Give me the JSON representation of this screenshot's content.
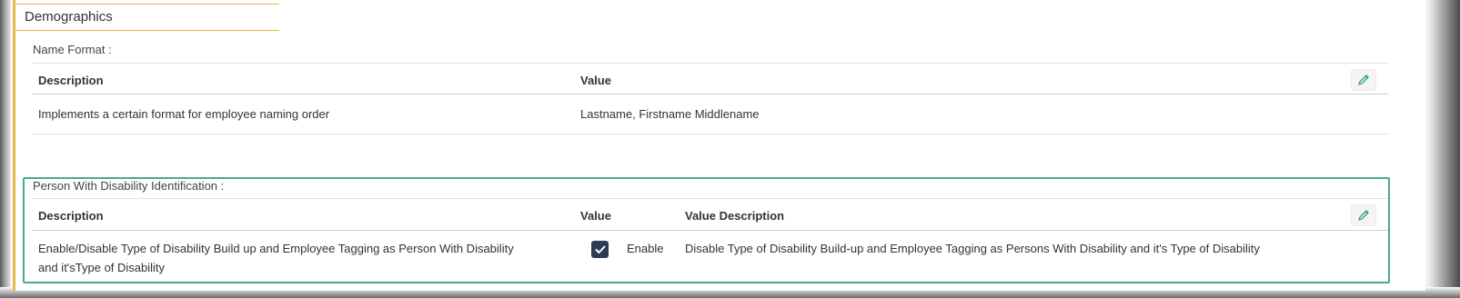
{
  "section": {
    "title": "Demographics"
  },
  "name_format": {
    "label": "Name Format :",
    "headers": {
      "description": "Description",
      "value": "Value"
    },
    "row": {
      "description": "Implements a certain format for employee naming order",
      "value": "Lastname, Firstname Middlename"
    }
  },
  "pwd": {
    "label": "Person With Disability Identification :",
    "headers": {
      "description": "Description",
      "value": "Value",
      "value_description": "Value Description"
    },
    "row": {
      "description_line1": "Enable/Disable Type of Disability Build up and Employee Tagging as Person With Disability",
      "description_line2": "and it'sType of Disability",
      "checked": true,
      "value": "Enable",
      "value_description": "Disable Type of Disability Build-up and Employee Tagging as Persons With Disability and it's Type of Disability"
    }
  },
  "colors": {
    "accent_gold": "#e6b74a",
    "highlight_green": "#4aa98a",
    "edit_icon_green": "#3aa76d",
    "checkbox_fill": "#2f3b52"
  },
  "icons": {
    "edit": "pencil-icon",
    "check": "checkmark-icon"
  }
}
